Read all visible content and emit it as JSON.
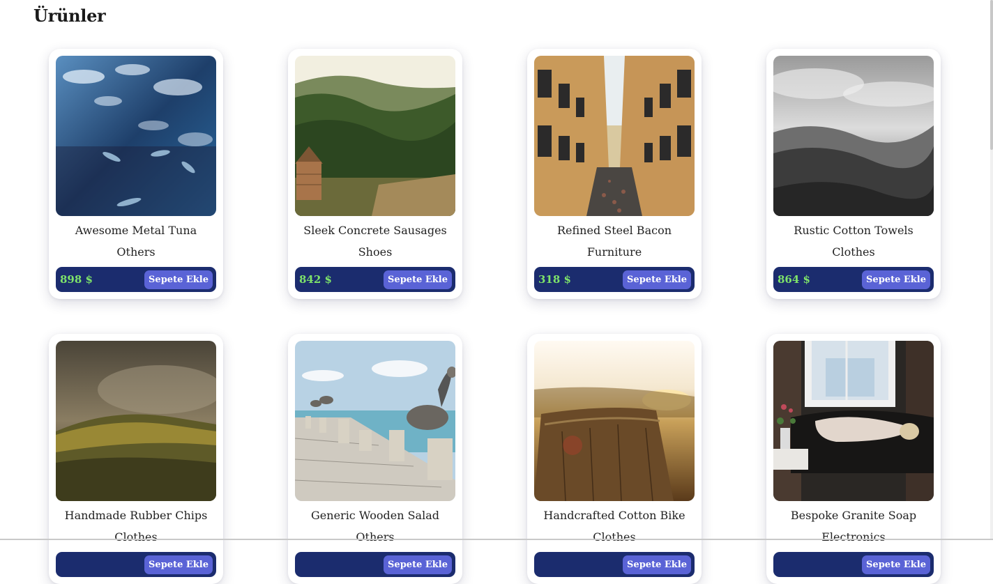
{
  "page": {
    "title": "Ürünler"
  },
  "products": [
    {
      "name": "Awesome Metal Tuna",
      "category": "Others",
      "price": "898 $",
      "button": "Sepete Ekle",
      "image": "fish-underwater-photo"
    },
    {
      "name": "Sleek Concrete Sausages",
      "category": "Shoes",
      "price": "842 $",
      "button": "Sepete Ekle",
      "image": "forest-hut-photo"
    },
    {
      "name": "Refined Steel Bacon",
      "category": "Furniture",
      "price": "318 $",
      "button": "Sepete Ekle",
      "image": "city-street-photo"
    },
    {
      "name": "Rustic Cotton Towels",
      "category": "Clothes",
      "price": "864 $",
      "button": "Sepete Ekle",
      "image": "bw-valley-photo"
    },
    {
      "name": "Handmade Rubber Chips",
      "category": "Clothes",
      "price": "",
      "button": "Sepete Ekle",
      "image": "foggy-hills-photo"
    },
    {
      "name": "Generic Wooden Salad",
      "category": "Others",
      "price": "",
      "button": "Sepete Ekle",
      "image": "pelican-pier-photo"
    },
    {
      "name": "Handcrafted Cotton Bike",
      "category": "Clothes",
      "price": "",
      "button": "Sepete Ekle",
      "image": "tree-stump-photo"
    },
    {
      "name": "Bespoke Granite Soap",
      "category": "Electronics",
      "price": "",
      "button": "Sepete Ekle",
      "image": "sleeping-woman-photo"
    }
  ],
  "colors": {
    "price_bar": "#1b2c6e",
    "price_text": "#7ee36a",
    "button_bg": "#5a63d6",
    "button_text": "#ffffff"
  }
}
